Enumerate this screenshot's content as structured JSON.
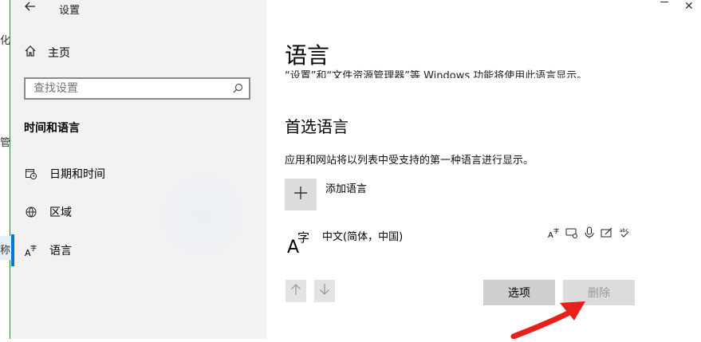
{
  "window": {
    "title": "设置",
    "back_icon": "back-arrow-icon"
  },
  "background_fragments": [
    "化",
    "管",
    "称"
  ],
  "sidebar": {
    "home_label": "主页",
    "search_placeholder": "查找设置",
    "section_title": "时间和语言",
    "items": [
      {
        "label": "日期和时间",
        "icon": "calendar-clock-icon"
      },
      {
        "label": "区域",
        "icon": "globe-icon"
      },
      {
        "label": "语言",
        "icon": "language-icon",
        "active": true
      }
    ]
  },
  "main": {
    "page_title": "语言",
    "cut_text": "“设置”和“文件资源管理器”等 Windows 功能将使用此语言显示。",
    "preferred": {
      "heading": "首选语言",
      "description": "应用和网站将以列表中受支持的第一种语言进行显示。",
      "add_label": "添加语言",
      "languages": [
        {
          "name": "中文(简体，中国)",
          "features": [
            "display-language-icon",
            "text-to-speech-icon",
            "speech-icon",
            "handwriting-icon",
            "spellcheck-icon"
          ]
        }
      ],
      "options_label": "选项",
      "remove_label": "删除"
    }
  },
  "colors": {
    "accent": "#0078d7",
    "sidebar_bg": "#f2f2f2",
    "button_bg": "#cfcfcf"
  }
}
